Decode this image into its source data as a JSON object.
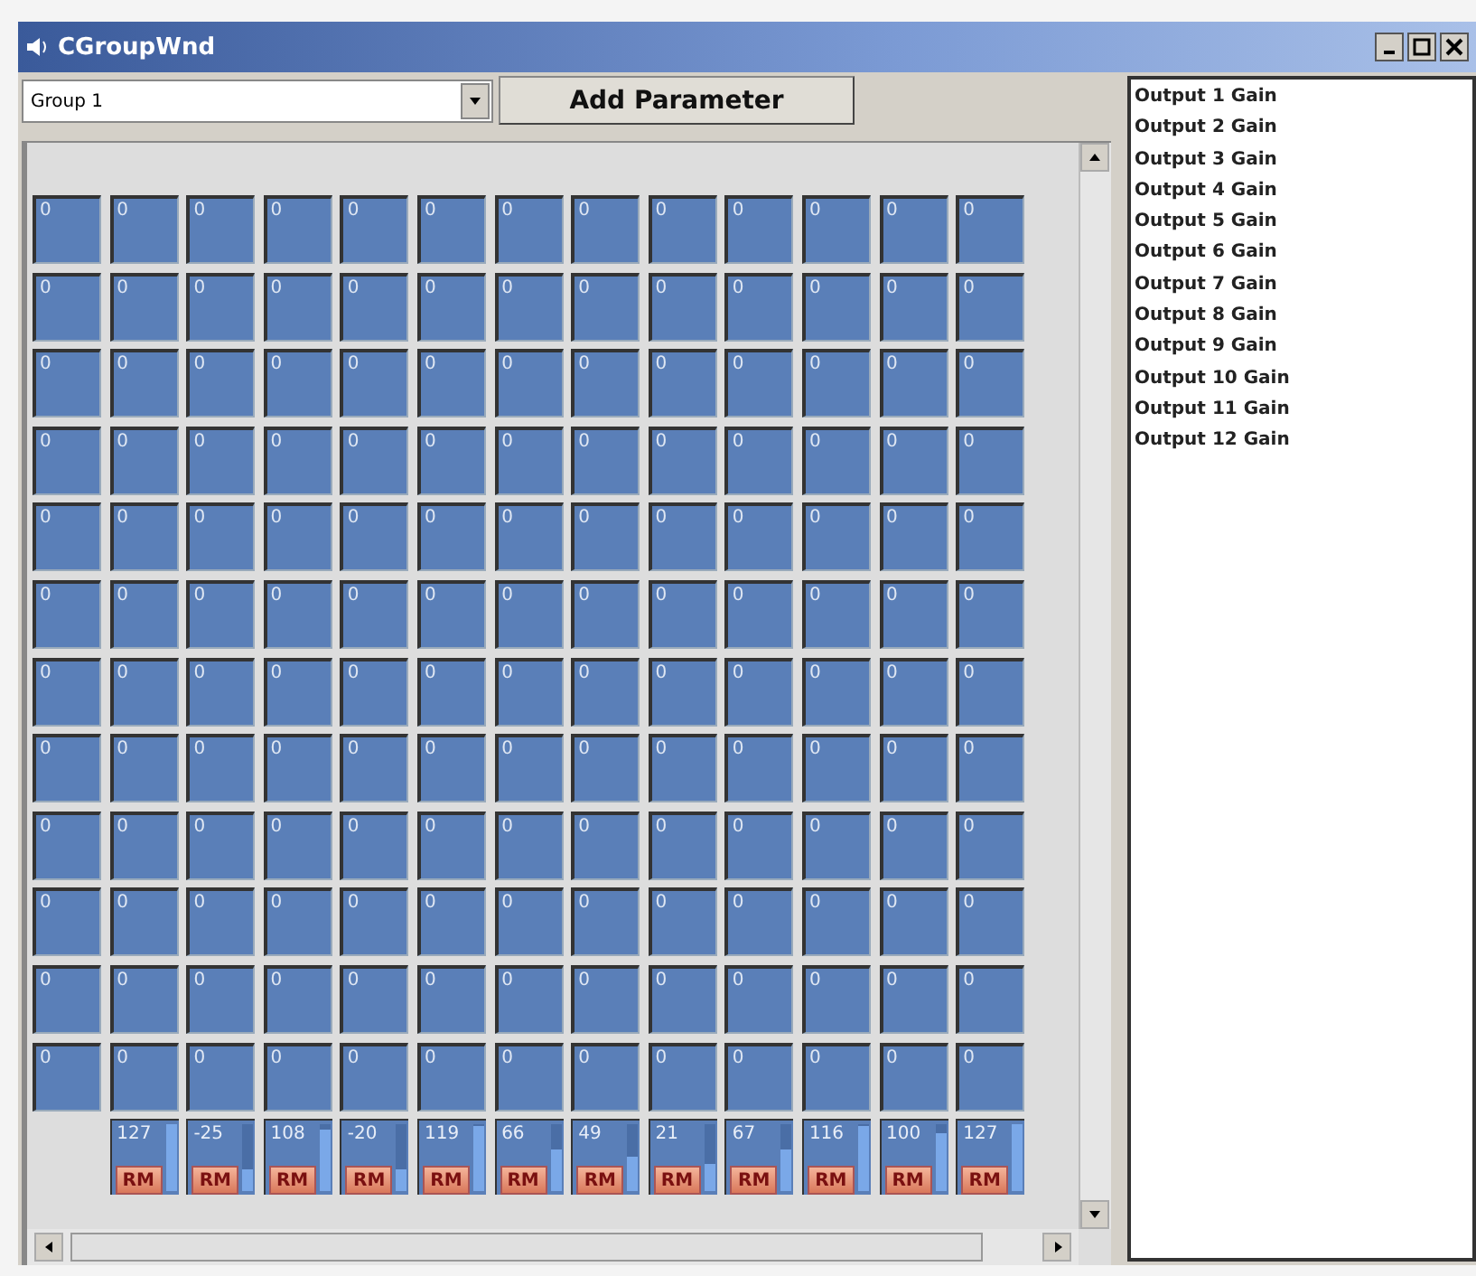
{
  "window": {
    "title": "CGroupWnd"
  },
  "group_select": {
    "value": "Group 1"
  },
  "add_button": {
    "label": "Add Parameter"
  },
  "grid": {
    "rows": [
      [
        "0",
        "0",
        "0",
        "0",
        "0",
        "0",
        "0",
        "0",
        "0",
        "0",
        "0",
        "0",
        "0"
      ],
      [
        "0",
        "0",
        "0",
        "0",
        "0",
        "0",
        "0",
        "0",
        "0",
        "0",
        "0",
        "0",
        "0"
      ],
      [
        "0",
        "0",
        "0",
        "0",
        "0",
        "0",
        "0",
        "0",
        "0",
        "0",
        "0",
        "0",
        "0"
      ],
      [
        "0",
        "0",
        "0",
        "0",
        "0",
        "0",
        "0",
        "0",
        "0",
        "0",
        "0",
        "0",
        "0"
      ],
      [
        "0",
        "0",
        "0",
        "0",
        "0",
        "0",
        "0",
        "0",
        "0",
        "0",
        "0",
        "0",
        "0"
      ],
      [
        "0",
        "0",
        "0",
        "0",
        "0",
        "0",
        "0",
        "0",
        "0",
        "0",
        "0",
        "0",
        "0"
      ],
      [
        "0",
        "0",
        "0",
        "0",
        "0",
        "0",
        "0",
        "0",
        "0",
        "0",
        "0",
        "0",
        "0"
      ],
      [
        "0",
        "0",
        "0",
        "0",
        "0",
        "0",
        "0",
        "0",
        "0",
        "0",
        "0",
        "0",
        "0"
      ],
      [
        "0",
        "0",
        "0",
        "0",
        "0",
        "0",
        "0",
        "0",
        "0",
        "0",
        "0",
        "0",
        "0"
      ],
      [
        "0",
        "0",
        "0",
        "0",
        "0",
        "0",
        "0",
        "0",
        "0",
        "0",
        "0",
        "0",
        "0"
      ],
      [
        "0",
        "0",
        "0",
        "0",
        "0",
        "0",
        "0",
        "0",
        "0",
        "0",
        "0",
        "0",
        "0"
      ],
      [
        "0",
        "0",
        "0",
        "0",
        "0",
        "0",
        "0",
        "0",
        "0",
        "0",
        "0",
        "0",
        "0"
      ]
    ]
  },
  "outputs": [
    {
      "value": "127",
      "button": "RM",
      "level": 1.0
    },
    {
      "value": "-25",
      "button": "RM",
      "level": 0.3
    },
    {
      "value": "108",
      "button": "RM",
      "level": 0.9
    },
    {
      "value": "-20",
      "button": "RM",
      "level": 0.3
    },
    {
      "value": "119",
      "button": "RM",
      "level": 0.95
    },
    {
      "value": "66",
      "button": "RM",
      "level": 0.6
    },
    {
      "value": "49",
      "button": "RM",
      "level": 0.5
    },
    {
      "value": "21",
      "button": "RM",
      "level": 0.4
    },
    {
      "value": "67",
      "button": "RM",
      "level": 0.6
    },
    {
      "value": "116",
      "button": "RM",
      "level": 0.95
    },
    {
      "value": "100",
      "button": "RM",
      "level": 0.85
    },
    {
      "value": "127",
      "button": "RM",
      "level": 1.0
    }
  ],
  "parameter_list": [
    "Output 1 Gain",
    "Output 2 Gain",
    "Output 3 Gain",
    "Output 4 Gain",
    "Output 5 Gain",
    "Output 6 Gain",
    "Output 7 Gain",
    "Output 8 Gain",
    "Output 9 Gain",
    "Output 10 Gain",
    "Output 11 Gain",
    "Output 12 Gain"
  ]
}
